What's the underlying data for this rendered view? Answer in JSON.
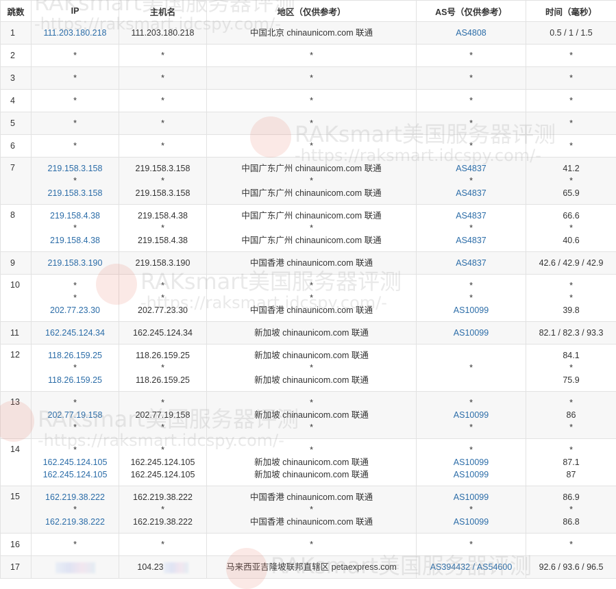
{
  "columns": [
    "跳数",
    "IP",
    "主机名",
    "地区（仅供参考）",
    "AS号（仅供参考）",
    "时间（毫秒）"
  ],
  "watermark": {
    "brand": "RAKsmart美国服务器评测",
    "url": "-https://raksmart.idcspy.com/-"
  },
  "rows": [
    {
      "hop": "1",
      "ip": [
        "111.203.180.218"
      ],
      "host": [
        "111.203.180.218"
      ],
      "region": [
        "中国北京 chinaunicom.com 联通"
      ],
      "as": [
        "AS4808"
      ],
      "time": [
        "0.5 / 1 / 1.5"
      ]
    },
    {
      "hop": "2",
      "ip": [
        "*"
      ],
      "host": [
        "*"
      ],
      "region": [
        "*"
      ],
      "as": [
        "*"
      ],
      "time": [
        "*"
      ]
    },
    {
      "hop": "3",
      "ip": [
        "*"
      ],
      "host": [
        "*"
      ],
      "region": [
        "*"
      ],
      "as": [
        "*"
      ],
      "time": [
        "*"
      ]
    },
    {
      "hop": "4",
      "ip": [
        "*"
      ],
      "host": [
        "*"
      ],
      "region": [
        "*"
      ],
      "as": [
        "*"
      ],
      "time": [
        "*"
      ]
    },
    {
      "hop": "5",
      "ip": [
        "*"
      ],
      "host": [
        "*"
      ],
      "region": [
        "*"
      ],
      "as": [
        "*"
      ],
      "time": [
        "*"
      ]
    },
    {
      "hop": "6",
      "ip": [
        "*"
      ],
      "host": [
        "*"
      ],
      "region": [
        "*"
      ],
      "as": [
        "*"
      ],
      "time": [
        "*"
      ]
    },
    {
      "hop": "7",
      "ip": [
        "219.158.3.158",
        "*",
        "219.158.3.158"
      ],
      "host": [
        "219.158.3.158",
        "*",
        "219.158.3.158"
      ],
      "region": [
        "中国广东广州 chinaunicom.com 联通",
        "*",
        "中国广东广州 chinaunicom.com 联通"
      ],
      "as": [
        "AS4837",
        "*",
        "AS4837"
      ],
      "time": [
        "41.2",
        "*",
        "65.9"
      ]
    },
    {
      "hop": "8",
      "ip": [
        "219.158.4.38",
        "*",
        "219.158.4.38"
      ],
      "host": [
        "219.158.4.38",
        "*",
        "219.158.4.38"
      ],
      "region": [
        "中国广东广州 chinaunicom.com 联通",
        "*",
        "中国广东广州 chinaunicom.com 联通"
      ],
      "as": [
        "AS4837",
        "*",
        "AS4837"
      ],
      "time": [
        "66.6",
        "*",
        "40.6"
      ]
    },
    {
      "hop": "9",
      "ip": [
        "219.158.3.190"
      ],
      "host": [
        "219.158.3.190"
      ],
      "region": [
        "中国香港 chinaunicom.com 联通"
      ],
      "as": [
        "AS4837"
      ],
      "time": [
        "42.6 / 42.9 / 42.9"
      ]
    },
    {
      "hop": "10",
      "ip": [
        "*",
        "*",
        "202.77.23.30"
      ],
      "host": [
        "*",
        "*",
        "202.77.23.30"
      ],
      "region": [
        "*",
        "*",
        "中国香港 chinaunicom.com 联通"
      ],
      "as": [
        "*",
        "*",
        "AS10099"
      ],
      "time": [
        "*",
        "*",
        "39.8"
      ]
    },
    {
      "hop": "11",
      "ip": [
        "162.245.124.34"
      ],
      "host": [
        "162.245.124.34"
      ],
      "region": [
        "新加坡 chinaunicom.com 联通"
      ],
      "as": [
        "AS10099"
      ],
      "time": [
        "82.1 / 82.3 / 93.3"
      ]
    },
    {
      "hop": "12",
      "ip": [
        "118.26.159.25",
        "*",
        "118.26.159.25"
      ],
      "host": [
        "118.26.159.25",
        "*",
        "118.26.159.25"
      ],
      "region": [
        "新加坡 chinaunicom.com 联通",
        "*",
        "新加坡 chinaunicom.com 联通"
      ],
      "as": [
        "*"
      ],
      "time": [
        "84.1",
        "*",
        "75.9"
      ]
    },
    {
      "hop": "13",
      "ip": [
        "*",
        "202.77.19.158",
        "*"
      ],
      "host": [
        "*",
        "202.77.19.158",
        "*"
      ],
      "region": [
        "*",
        "新加坡 chinaunicom.com 联通",
        "*"
      ],
      "as": [
        "*",
        "AS10099",
        "*"
      ],
      "time": [
        "*",
        "86",
        "*"
      ]
    },
    {
      "hop": "14",
      "ip": [
        "*",
        "162.245.124.105",
        "162.245.124.105"
      ],
      "host": [
        "*",
        "162.245.124.105",
        "162.245.124.105"
      ],
      "region": [
        "*",
        "新加坡 chinaunicom.com 联通",
        "新加坡 chinaunicom.com 联通"
      ],
      "as": [
        "*",
        "AS10099",
        "AS10099"
      ],
      "time": [
        "*",
        "87.1",
        "87"
      ]
    },
    {
      "hop": "15",
      "ip": [
        "162.219.38.222",
        "*",
        "162.219.38.222"
      ],
      "host": [
        "162.219.38.222",
        "*",
        "162.219.38.222"
      ],
      "region": [
        "中国香港 chinaunicom.com 联通",
        "*",
        "中国香港 chinaunicom.com 联通"
      ],
      "as": [
        "AS10099",
        "*",
        "AS10099"
      ],
      "time": [
        "86.9",
        "*",
        "86.8"
      ]
    },
    {
      "hop": "16",
      "ip": [
        "*"
      ],
      "host": [
        "*"
      ],
      "region": [
        "*"
      ],
      "as": [
        "*"
      ],
      "time": [
        "*"
      ]
    },
    {
      "hop": "17",
      "ip": [
        ""
      ],
      "host": [
        "104.23"
      ],
      "region": [
        "马来西亚吉隆坡联邦直辖区 petaexpress.com"
      ],
      "as": [
        "AS394432 / AS54600"
      ],
      "time": [
        "92.6 / 93.6 / 96.5"
      ],
      "ip_redacted": true,
      "host_redacted": true
    }
  ]
}
